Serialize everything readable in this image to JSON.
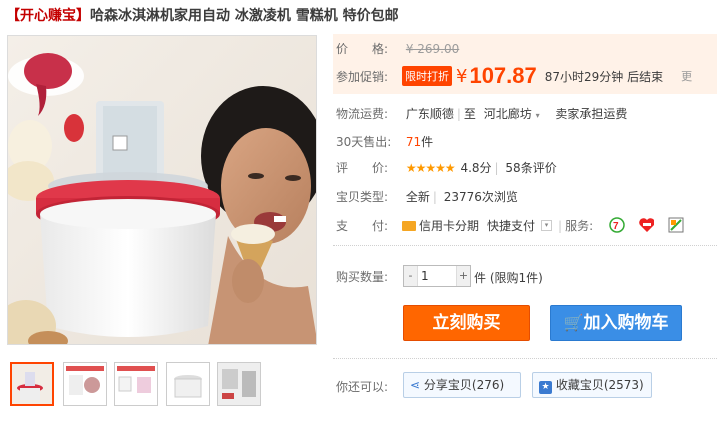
{
  "title": {
    "bracket": "【开心赚宝】",
    "text": "哈森冰淇淋机家用自动 冰激凌机 雪糕机 特价包邮"
  },
  "price": {
    "label": "价　　格:",
    "original": "¥ 269.00"
  },
  "promo": {
    "label": "参加促销:",
    "badge": "限时打折",
    "currency": "¥",
    "value": "107.87",
    "countdown": "87小时29分钟 后结束",
    "more": "更"
  },
  "shipping": {
    "label": "物流运费:",
    "from": "广东顺德",
    "to_sep": "至",
    "to": "河北廊坊",
    "cost": "卖家承担运费"
  },
  "sales": {
    "label": "30天售出:",
    "count": "71",
    "unit": "件"
  },
  "rating": {
    "label": "评　　价:",
    "stars": "★★★★★",
    "score": "4.8分",
    "reviews": "58条评价"
  },
  "type": {
    "label": "宝贝类型:",
    "value": "全新",
    "views": "23776次浏览"
  },
  "payment": {
    "label": "支　　付:",
    "method1": "信用卡分期",
    "method2": "快捷支付",
    "services_label": "服务:"
  },
  "quantity": {
    "label": "购买数量:",
    "value": "1",
    "minus": "-",
    "plus": "+",
    "limit": "件 (限购1件)"
  },
  "buttons": {
    "buy": "立刻购买",
    "cart": "加入购物车"
  },
  "social": {
    "label": "你还可以:",
    "share": "分享宝贝(276)",
    "fav": "收藏宝贝(2573)"
  },
  "colors": {
    "accent": "#ff4400",
    "buy": "#ff6600",
    "cart": "#3a8ee6"
  }
}
